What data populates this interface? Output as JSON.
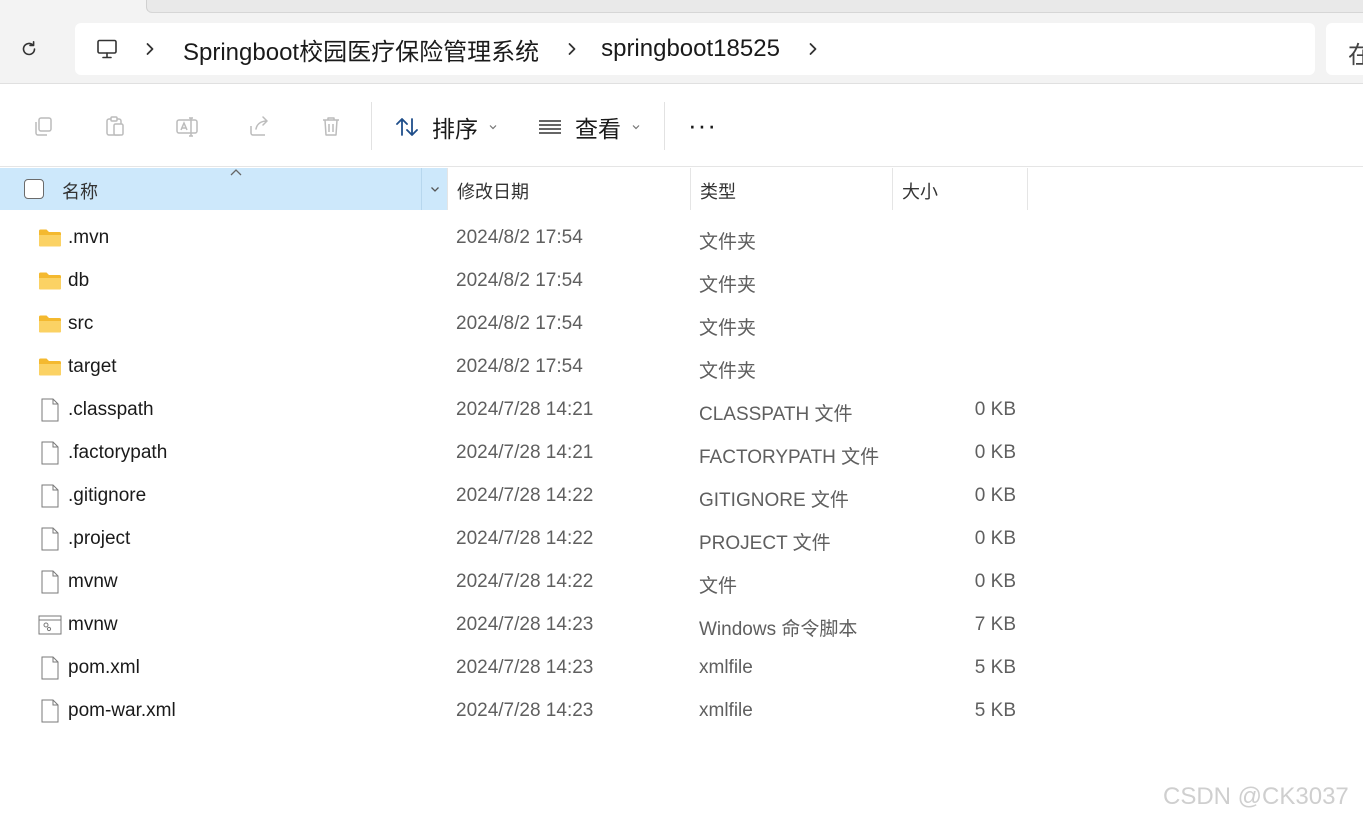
{
  "address_bar": {
    "breadcrumbs": [
      "Springboot校园医疗保险管理系统",
      "springboot18525"
    ],
    "search_partial": "在"
  },
  "command_bar": {
    "sort_label": "排序",
    "view_label": "查看",
    "more_label": "···"
  },
  "columns": {
    "name": "名称",
    "date": "修改日期",
    "type": "类型",
    "size": "大小"
  },
  "files": [
    {
      "name": ".mvn",
      "date": "2024/8/2 17:54",
      "type": "文件夹",
      "size": "",
      "icon": "folder-icon"
    },
    {
      "name": "db",
      "date": "2024/8/2 17:54",
      "type": "文件夹",
      "size": "",
      "icon": "folder-icon"
    },
    {
      "name": "src",
      "date": "2024/8/2 17:54",
      "type": "文件夹",
      "size": "",
      "icon": "folder-icon"
    },
    {
      "name": "target",
      "date": "2024/8/2 17:54",
      "type": "文件夹",
      "size": "",
      "icon": "folder-icon"
    },
    {
      "name": ".classpath",
      "date": "2024/7/28 14:21",
      "type": "CLASSPATH 文件",
      "size": "0 KB",
      "icon": "file-icon"
    },
    {
      "name": ".factorypath",
      "date": "2024/7/28 14:21",
      "type": "FACTORYPATH 文件",
      "size": "0 KB",
      "icon": "file-icon"
    },
    {
      "name": ".gitignore",
      "date": "2024/7/28 14:22",
      "type": "GITIGNORE 文件",
      "size": "0 KB",
      "icon": "file-icon"
    },
    {
      "name": ".project",
      "date": "2024/7/28 14:22",
      "type": "PROJECT 文件",
      "size": "0 KB",
      "icon": "file-icon"
    },
    {
      "name": "mvnw",
      "date": "2024/7/28 14:22",
      "type": "文件",
      "size": "0 KB",
      "icon": "file-icon"
    },
    {
      "name": "mvnw",
      "date": "2024/7/28 14:23",
      "type": "Windows 命令脚本",
      "size": "7 KB",
      "icon": "script-file-icon"
    },
    {
      "name": "pom.xml",
      "date": "2024/7/28 14:23",
      "type": "xmlfile",
      "size": "5 KB",
      "icon": "file-icon"
    },
    {
      "name": "pom-war.xml",
      "date": "2024/7/28 14:23",
      "type": "xmlfile",
      "size": "5 KB",
      "icon": "file-icon"
    }
  ],
  "watermark": "CSDN @CK3037",
  "colors": {
    "selected_header_bg": "#cde8fb",
    "folder_yellow": "#f8c53a",
    "secondary_text": "#5f5f5f"
  }
}
